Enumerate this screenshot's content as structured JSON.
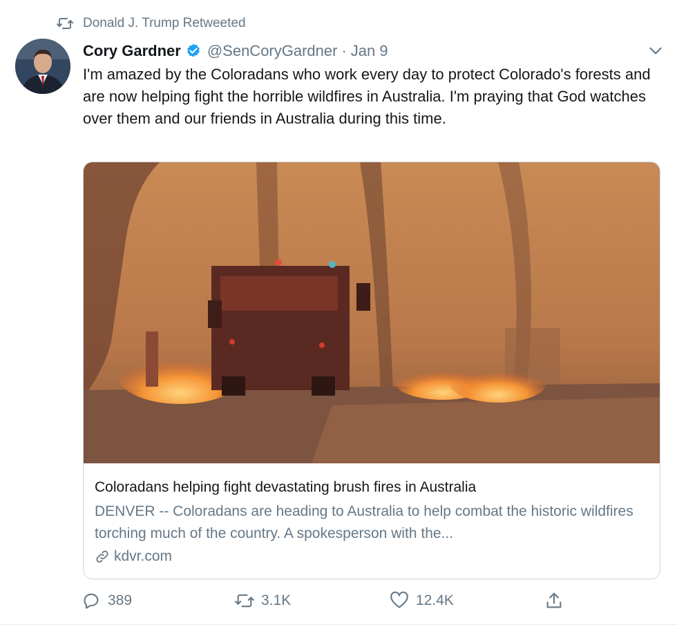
{
  "retweet": {
    "label": "Donald J. Trump Retweeted"
  },
  "tweet": {
    "author_name": "Cory Gardner",
    "handle": "@SenCoryGardner",
    "separator": "·",
    "date": "Jan 9",
    "text": "I'm amazed by the Coloradans who work every day to protect Colorado's forests and are now helping fight the horrible wildfires in Australia. I'm praying that God watches over them and our friends in Australia during this time."
  },
  "card": {
    "title": "Coloradans helping fight devastating brush fires in Australia",
    "description": "DENVER -- Coloradans are heading to Australia to help combat the historic wildfires torching much of the country. A spokesperson with the...",
    "domain": "kdvr.com"
  },
  "actions": {
    "replies": "389",
    "retweets": "3.1K",
    "likes": "12.4K"
  },
  "colors": {
    "muted": "#657786",
    "verified": "#1da1f2",
    "border": "#ccd6dd"
  }
}
